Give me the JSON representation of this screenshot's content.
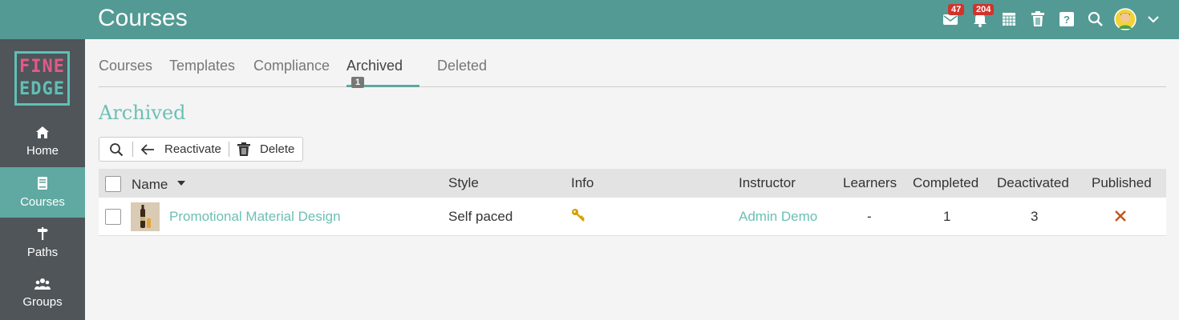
{
  "header": {
    "title": "Courses",
    "messages_count": "47",
    "notifications_count": "204",
    "icons": [
      "messages-icon",
      "notifications-icon",
      "calendar-icon",
      "trash-icon",
      "help-icon",
      "search-icon",
      "avatar",
      "chevron-down-icon"
    ]
  },
  "logo": {
    "line1": "FINE",
    "line2": "EDGE"
  },
  "sidebar": {
    "items": [
      {
        "label": "Home",
        "icon": "home-icon"
      },
      {
        "label": "Courses",
        "icon": "book-icon",
        "active": true
      },
      {
        "label": "Paths",
        "icon": "signpost-icon"
      },
      {
        "label": "Groups",
        "icon": "users-icon"
      }
    ]
  },
  "tabs": [
    {
      "label": "Courses"
    },
    {
      "label": "Templates"
    },
    {
      "label": "Compliance"
    },
    {
      "label": "Archived",
      "count": "1",
      "active": true
    },
    {
      "label": "Deleted"
    }
  ],
  "section": {
    "title": "Archived"
  },
  "toolbar": {
    "reactivate_label": "Reactivate",
    "delete_label": "Delete"
  },
  "table": {
    "columns": [
      "Name",
      "Style",
      "Info",
      "Instructor",
      "Learners",
      "Completed",
      "Deactivated",
      "Published"
    ],
    "rows": [
      {
        "name": "Promotional Material Design",
        "style": "Self paced",
        "info_icon": "key-icon",
        "instructor": "Admin Demo",
        "learners": "-",
        "completed": "1",
        "deactivated": "3",
        "published_icon": "cross-icon"
      }
    ]
  },
  "colors": {
    "topbar": "#539a94",
    "sidebar": "#4f5559",
    "accent": "#6cc0b5",
    "badge": "#d0342c",
    "key": "#d4a000",
    "cross": "#c0561b"
  }
}
